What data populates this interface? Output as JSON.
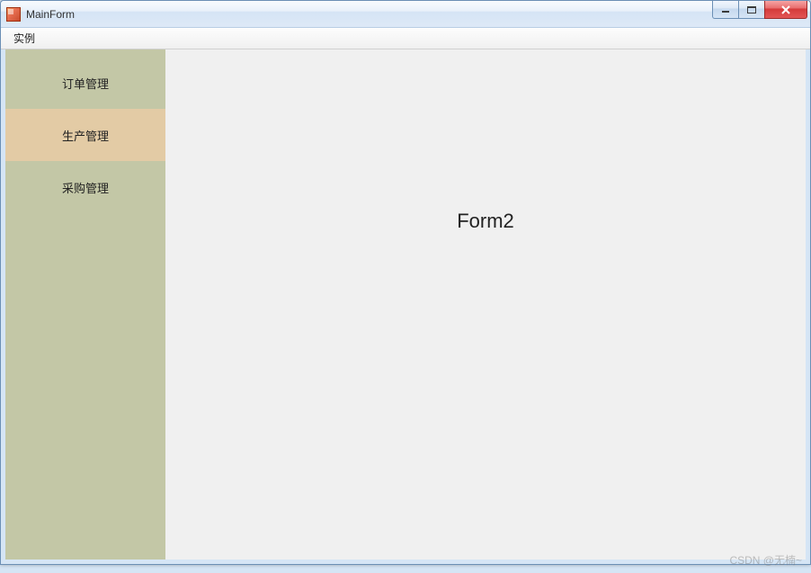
{
  "window": {
    "title": "MainForm"
  },
  "menubar": {
    "items": [
      {
        "label": "实例"
      }
    ]
  },
  "sidebar": {
    "items": [
      {
        "label": "订单管理",
        "selected": false
      },
      {
        "label": "生产管理",
        "selected": true
      },
      {
        "label": "采购管理",
        "selected": false
      }
    ]
  },
  "content": {
    "heading": "Form2"
  },
  "watermark": "CSDN @无楠~"
}
